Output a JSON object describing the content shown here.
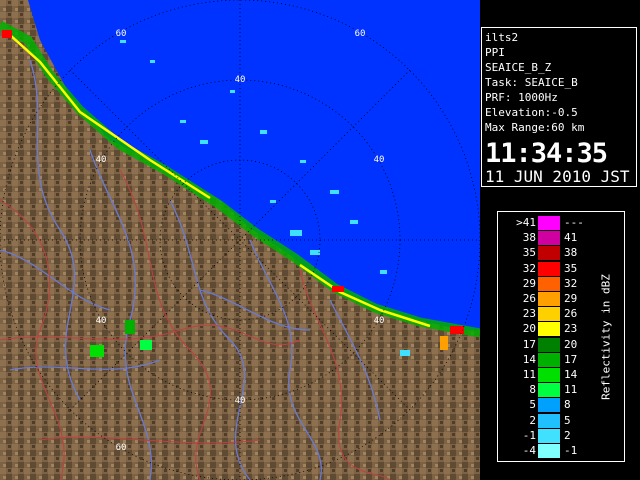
{
  "info": {
    "lines": [
      "ilts2",
      "PPI",
      "SEAICE_B_Z",
      "Task: SEAICE_B",
      "PRF: 1000Hz",
      "Elevation:-0.5",
      "Max Range:60 km"
    ],
    "time": "11:34:35",
    "date": "11 JUN 2010 JST"
  },
  "legend": {
    "title": "Reflectivity in dBZ",
    "rows": [
      {
        "lo": ">41",
        "hi": "---",
        "color": "#ff00ff"
      },
      {
        "lo": "38",
        "hi": "41",
        "color": "#d000a0"
      },
      {
        "lo": "35",
        "hi": "38",
        "color": "#c00000"
      },
      {
        "lo": "32",
        "hi": "35",
        "color": "#ff0000"
      },
      {
        "lo": "29",
        "hi": "32",
        "color": "#ff6000"
      },
      {
        "lo": "26",
        "hi": "29",
        "color": "#ffa000"
      },
      {
        "lo": "23",
        "hi": "26",
        "color": "#ffd000"
      },
      {
        "lo": "20",
        "hi": "23",
        "color": "#ffff00"
      },
      {
        "lo": "17",
        "hi": "20",
        "color": "#008000"
      },
      {
        "lo": "14",
        "hi": "17",
        "color": "#00b000"
      },
      {
        "lo": "11",
        "hi": "14",
        "color": "#00e000"
      },
      {
        "lo": "8",
        "hi": "11",
        "color": "#00ff40"
      },
      {
        "lo": "5",
        "hi": "8",
        "color": "#00a0ff"
      },
      {
        "lo": "2",
        "hi": "5",
        "color": "#20c0ff"
      },
      {
        "lo": "-1",
        "hi": "2",
        "color": "#40e0ff"
      },
      {
        "lo": "-4",
        "hi": "-1",
        "color": "#80ffff"
      }
    ]
  },
  "range_labels": {
    "r60_top": "60",
    "r60_topright": "60",
    "r40_top": "40",
    "r40_left": "40",
    "r40_right": "40",
    "r40_lowright": "40",
    "r40_lowleft": "40",
    "r40_bottom": "40",
    "r60_bottom": "60"
  },
  "colors": {
    "sea": "#0033ff",
    "land": "#7a6040",
    "rivers": "#6a7ad0",
    "borders": "#c04040",
    "grid": "#000000"
  }
}
